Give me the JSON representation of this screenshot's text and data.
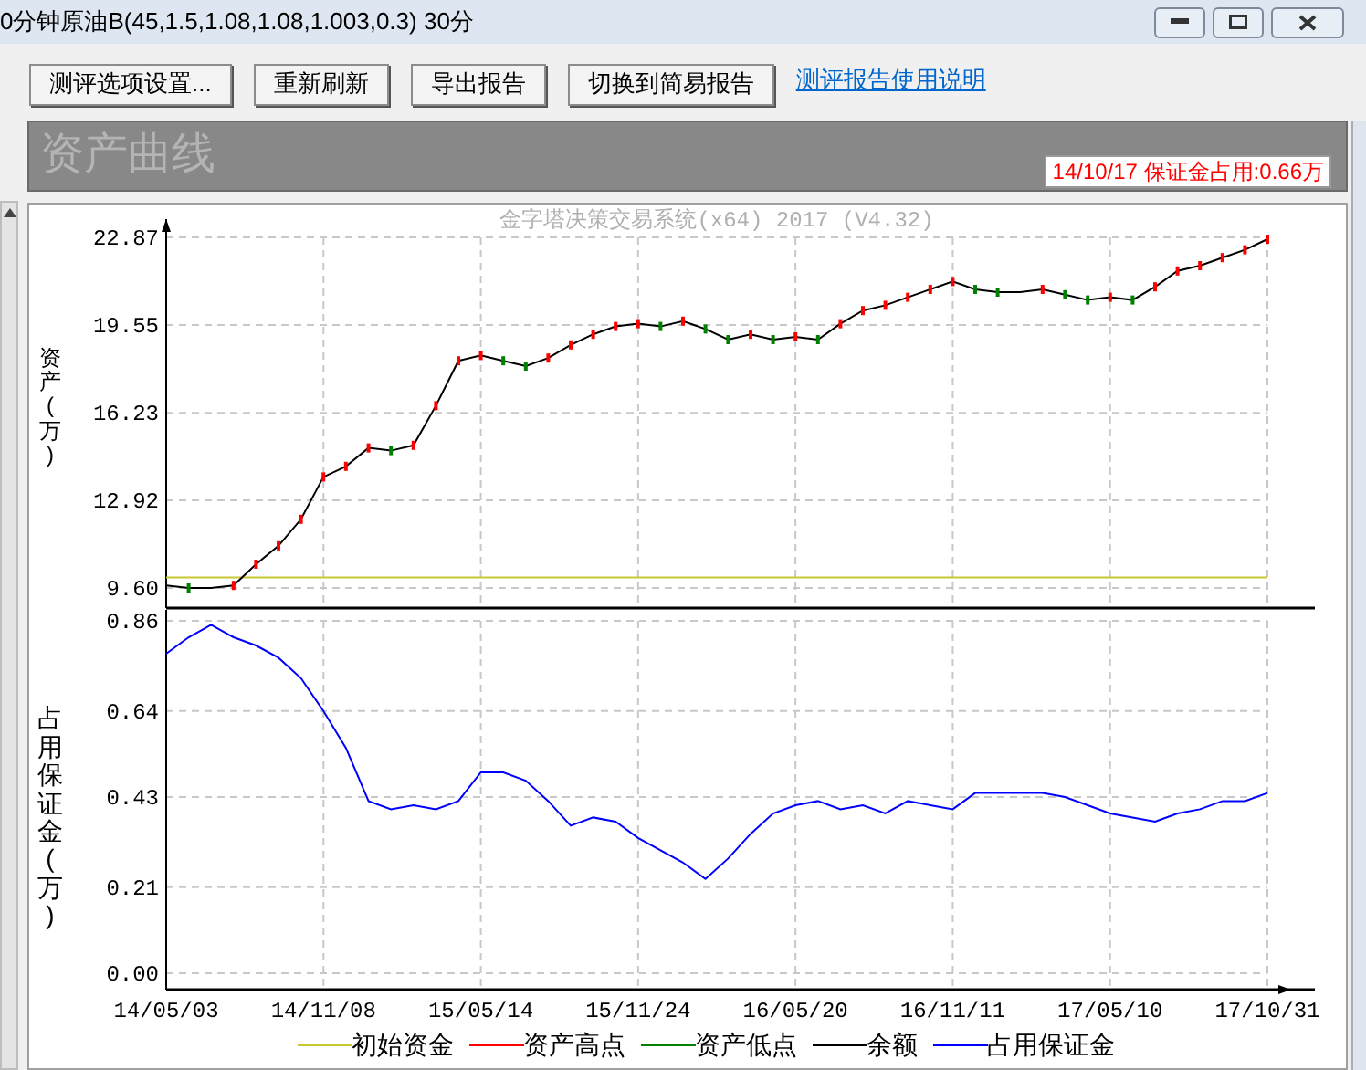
{
  "window": {
    "title": "0分钟原油B(45,1.5,1.08,1.08,1.003,0.3) 30分"
  },
  "toolbar": {
    "buttons": [
      "测评选项设置...",
      "重新刷新",
      "导出报告",
      "切换到简易报告"
    ],
    "link": "测评报告使用说明"
  },
  "section": {
    "title": "资产曲线",
    "annotation": "14/10/17 保证金占用:0.66万"
  },
  "asset_chart": {
    "chart_data": {
      "type": "line",
      "title": "金字塔决策交易系统(x64) 2017 (V4.32)",
      "ylabel": "资产(万)",
      "grid": true,
      "ylim": [
        9.6,
        22.87
      ],
      "yticks": [
        {
          "value": 22.87,
          "label": "22.87"
        },
        {
          "value": 19.55,
          "label": "19.55"
        },
        {
          "value": 16.23,
          "label": "16.23"
        },
        {
          "value": 12.92,
          "label": "12.92"
        },
        {
          "value": 9.6,
          "label": "9.60"
        }
      ],
      "series": [
        {
          "name": "初始资金",
          "color": "#c8c832",
          "values": [
            10,
            10,
            10,
            10,
            10,
            10,
            10,
            10,
            10,
            10,
            10,
            10,
            10,
            10,
            10,
            10,
            10,
            10,
            10,
            10,
            10,
            10,
            10,
            10,
            10,
            10,
            10,
            10,
            10,
            10,
            10,
            10,
            10,
            10,
            10,
            10,
            10,
            10,
            10,
            10,
            10,
            10,
            10,
            10,
            10,
            10,
            10,
            10,
            10,
            10
          ]
        },
        {
          "name": "余额",
          "color": "#000000",
          "marker": "square",
          "values": [
            9.7,
            9.6,
            9.6,
            9.7,
            10.5,
            11.2,
            12.2,
            13.8,
            14.2,
            14.9,
            14.8,
            15.0,
            16.5,
            18.2,
            18.4,
            18.2,
            18.0,
            18.3,
            18.8,
            19.2,
            19.5,
            19.6,
            19.5,
            19.7,
            19.4,
            19.0,
            19.2,
            19.0,
            19.1,
            19.0,
            19.6,
            20.1,
            20.3,
            20.6,
            20.9,
            21.2,
            20.9,
            20.8,
            20.8,
            20.9,
            20.7,
            20.5,
            20.6,
            20.5,
            21.0,
            21.6,
            21.8,
            22.1,
            22.4,
            22.8
          ]
        }
      ]
    }
  },
  "asset_markers": [
    {
      "label": "资产高点",
      "color": "#ff0000"
    },
    {
      "label": "资产低点",
      "color": "#008000"
    }
  ],
  "margin_chart": {
    "chart_data": {
      "type": "line",
      "ylabel": "占用保证金(万)",
      "grid": true,
      "ylim": [
        0,
        0.86
      ],
      "categories": [
        "14/05/03",
        null,
        null,
        null,
        null,
        null,
        null,
        "14/11/08",
        null,
        null,
        null,
        null,
        null,
        null,
        "15/05/14",
        null,
        null,
        null,
        null,
        null,
        null,
        "15/11/24",
        null,
        null,
        null,
        null,
        null,
        null,
        "16/05/20",
        null,
        null,
        null,
        null,
        null,
        null,
        "16/11/11",
        null,
        null,
        null,
        null,
        null,
        null,
        "17/05/10",
        null,
        null,
        null,
        null,
        null,
        null,
        "17/10/31"
      ],
      "yticks": [
        {
          "value": 0.86,
          "label": "0.86"
        },
        {
          "value": 0.64,
          "label": "0.64"
        },
        {
          "value": 0.43,
          "label": "0.43"
        },
        {
          "value": 0.21,
          "label": "0.21"
        },
        {
          "value": 0,
          "label": "0.00"
        }
      ],
      "series": [
        {
          "name": "占用保证金",
          "color": "#0000ff",
          "values": [
            0.78,
            0.82,
            0.85,
            0.82,
            0.8,
            0.77,
            0.72,
            0.64,
            0.55,
            0.42,
            0.4,
            0.41,
            0.4,
            0.42,
            0.49,
            0.49,
            0.47,
            0.42,
            0.36,
            0.38,
            0.37,
            0.33,
            0.3,
            0.27,
            0.23,
            0.28,
            0.34,
            0.39,
            0.41,
            0.42,
            0.4,
            0.41,
            0.39,
            0.42,
            0.41,
            0.4,
            0.44,
            0.44,
            0.44,
            0.44,
            0.43,
            0.41,
            0.39,
            0.38,
            0.37,
            0.39,
            0.4,
            0.42,
            0.42,
            0.44
          ]
        }
      ]
    }
  }
}
